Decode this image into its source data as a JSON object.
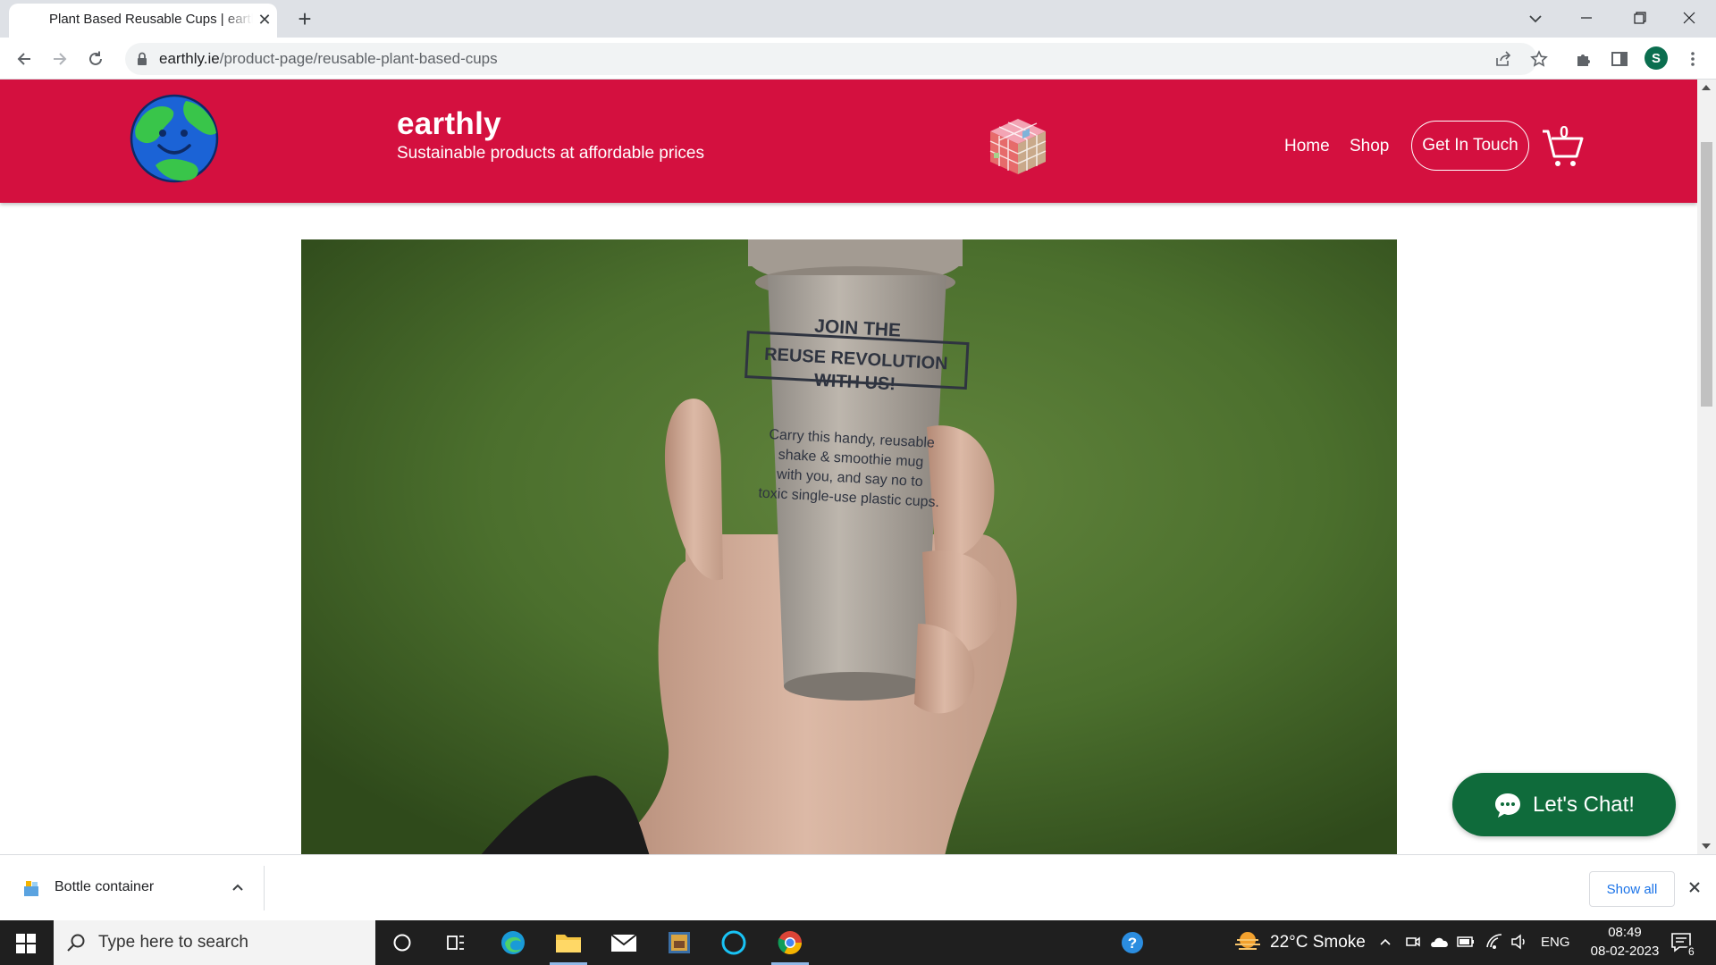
{
  "browser": {
    "tab_title": "Plant Based Reusable Cups | earthly",
    "url_host": "earthly.ie",
    "url_path": "/product-page/reusable-plant-based-cups",
    "profile_initial": "S"
  },
  "site": {
    "brand": "earthly",
    "tagline": "Sustainable products at affordable prices",
    "nav": {
      "home": "Home",
      "shop": "Shop",
      "contact": "Get In Touch"
    },
    "cart_count": "0",
    "chat_label": "Let's Chat!"
  },
  "downloads": {
    "file_name": "Bottle container",
    "show_all": "Show all"
  },
  "taskbar": {
    "search_placeholder": "Type here to search",
    "weather": "22°C  Smoke",
    "language": "ENG",
    "time": "08:49",
    "date": "08-02-2023",
    "notification_count": "6"
  },
  "colors": {
    "header_red": "#d4103f",
    "chat_green": "#0f6b3b"
  }
}
